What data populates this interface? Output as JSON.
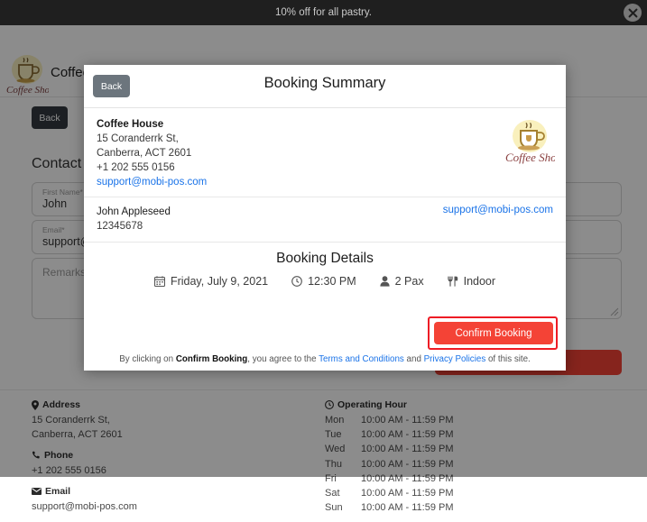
{
  "promo": {
    "text": "10% off for all pastry.",
    "close_icon": "close-circle-icon"
  },
  "site_header": {
    "brand_title": "Coffee House",
    "logo_alt": "Coffee Shop"
  },
  "background_page": {
    "back_label": "Back",
    "contact_heading": "Contact",
    "fields": [
      {
        "label": "First Name*",
        "value": "John",
        "placeholder": ""
      },
      {
        "label": "Email*",
        "value": "support@m",
        "placeholder": ""
      },
      {
        "label": "",
        "value": "",
        "placeholder": ""
      },
      {
        "label": "",
        "value": "",
        "placeholder": ""
      },
      {
        "label": "",
        "value": "",
        "placeholder": "Remarks"
      }
    ]
  },
  "footer": {
    "address_head": "Address",
    "address_lines": [
      "15 Coranderrk St,",
      "Canberra, ACT 2601"
    ],
    "phone_head": "Phone",
    "phone_value": "+1 202 555 0156",
    "email_head": "Email",
    "email_value": "support@mobi-pos.com",
    "hours_head": "Operating Hour",
    "hours": [
      {
        "day": "Mon",
        "time": "10:00 AM - 11:59 PM"
      },
      {
        "day": "Tue",
        "time": "10:00 AM - 11:59 PM"
      },
      {
        "day": "Wed",
        "time": "10:00 AM - 11:59 PM"
      },
      {
        "day": "Thu",
        "time": "10:00 AM - 11:59 PM"
      },
      {
        "day": "Fri",
        "time": "10:00 AM - 11:59 PM"
      },
      {
        "day": "Sat",
        "time": "10:00 AM - 11:59 PM"
      },
      {
        "day": "Sun",
        "time": "10:00 AM - 11:59 PM"
      }
    ]
  },
  "modal": {
    "back_label": "Back",
    "title": "Booking Summary",
    "merchant": {
      "name": "Coffee House",
      "address_line1": "15 Coranderrk St,",
      "address_line2": "Canberra, ACT 2601",
      "phone": "+1 202 555 0156",
      "email": "support@mobi-pos.com"
    },
    "customer": {
      "name": "John Appleseed",
      "phone": "12345678",
      "email": "support@mobi-pos.com"
    },
    "details": {
      "title": "Booking Details",
      "date": "Friday, July 9, 2021",
      "time": "12:30 PM",
      "pax": "2 Pax",
      "area": "Indoor",
      "date_icon": "calendar-icon",
      "time_icon": "clock-icon",
      "pax_icon": "person-icon",
      "area_icon": "cutlery-icon"
    },
    "confirm_label": "Confirm Booking",
    "disclaimer": {
      "prefix": "By clicking on ",
      "bold": "Confirm Booking",
      "middle": ", you agree to the ",
      "terms_link": "Terms and Conditions",
      "conjunction": " and ",
      "privacy_link": "Privacy Policies",
      "suffix": " of this site."
    }
  },
  "colors": {
    "promo_bg": "#1f1f1f",
    "accent_red": "#f44336",
    "highlight_red": "#ee1c25",
    "link_blue": "#1a73e8",
    "back_gray": "#6c757d"
  }
}
